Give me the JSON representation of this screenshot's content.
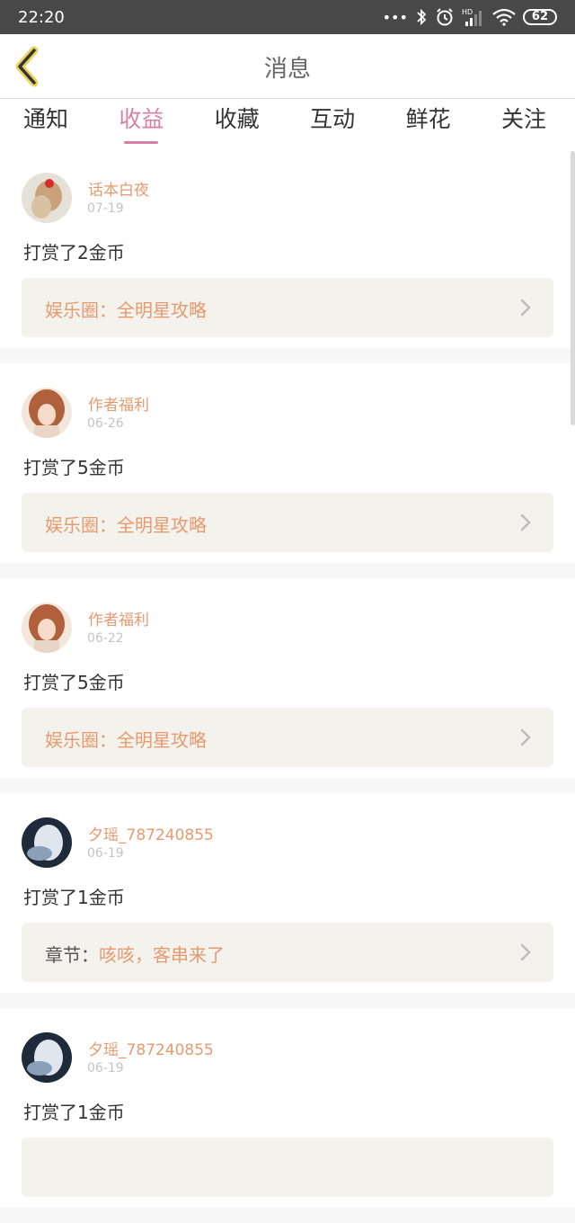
{
  "status_bar": {
    "time": "22:20",
    "battery": "62"
  },
  "header": {
    "title": "消息"
  },
  "tabs": [
    {
      "label": "通知"
    },
    {
      "label": "收益",
      "active": true
    },
    {
      "label": "收藏"
    },
    {
      "label": "互动"
    },
    {
      "label": "鲜花"
    },
    {
      "label": "关注"
    }
  ],
  "messages": [
    {
      "user": "话本白夜",
      "date": "07-19",
      "action": "打赏了2金币",
      "link_label": "娱乐圈：",
      "link_title": "全明星攻略"
    },
    {
      "user": "作者福利",
      "date": "06-26",
      "action": "打赏了5金币",
      "link_label": "娱乐圈：",
      "link_title": "全明星攻略"
    },
    {
      "user": "作者福利",
      "date": "06-22",
      "action": "打赏了5金币",
      "link_label": "娱乐圈：",
      "link_title": "全明星攻略"
    },
    {
      "user": "夕瑶_787240855",
      "date": "06-19",
      "action": "打赏了1金币",
      "link_label": "章节：",
      "link_title": "咳咳，客串来了"
    },
    {
      "user": "夕瑶_787240855",
      "date": "06-19",
      "action": "打赏了1金币",
      "link_label": "",
      "link_title": ""
    }
  ],
  "colors": {
    "accent": "#d580a8",
    "name": "#e69a6f",
    "link_bg": "#f4f2ec"
  }
}
